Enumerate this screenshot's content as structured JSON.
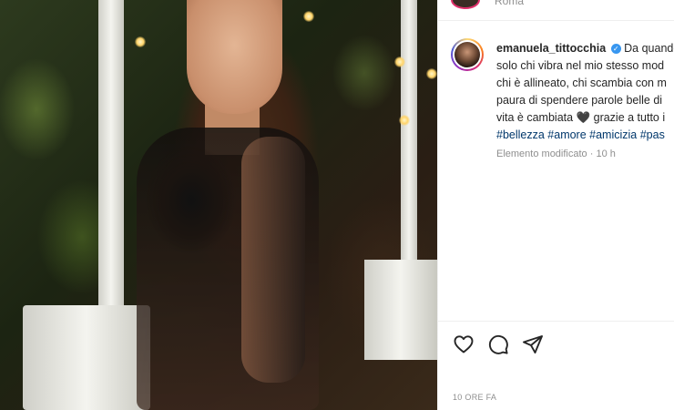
{
  "post": {
    "location": "Roma",
    "username": "emanuela_tittocchia",
    "caption_lines": [
      "Da quando",
      "solo chi vibra nel mio stesso mod",
      "chi è allineato, chi scambia con m",
      "paura di spendere parole belle di",
      "vita è cambiata"
    ],
    "caption_tail": " grazie a tutto i",
    "hashtags": "#bellezza #amore #amicizia #pas",
    "edited_label": "Elemento modificato",
    "time_ago": "10 h",
    "timestamp": "10 ORE FA"
  },
  "icons": [
    "verified-badge-icon",
    "heart-icon",
    "comment-icon",
    "share-icon",
    "black-heart-emoji"
  ],
  "colors": {
    "link": "#00376b",
    "verified": "#3897f0",
    "muted": "#8e8e8e"
  }
}
